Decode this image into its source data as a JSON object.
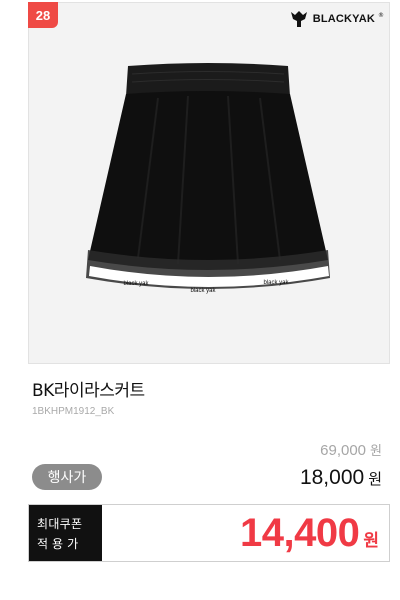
{
  "product": {
    "rank": "28",
    "brand": "BLACKYAK",
    "brand_mark": "®",
    "hem_text": "black yak",
    "name": "BK라이라스커트",
    "code": "1BKHPM1912_BK",
    "original_price": "69,000",
    "original_unit": "원",
    "event_badge": "행사가",
    "sale_price": "18,000",
    "sale_unit": "원",
    "coupon_label_line1": "최대쿠폰",
    "coupon_label_line2": "적용가",
    "coupon_price": "14,400",
    "coupon_unit": "원"
  },
  "colors": {
    "badge_red": "#ef4a45",
    "coupon_red": "#f03a45",
    "event_gray": "#8c8c8c",
    "label_black": "#111111"
  }
}
